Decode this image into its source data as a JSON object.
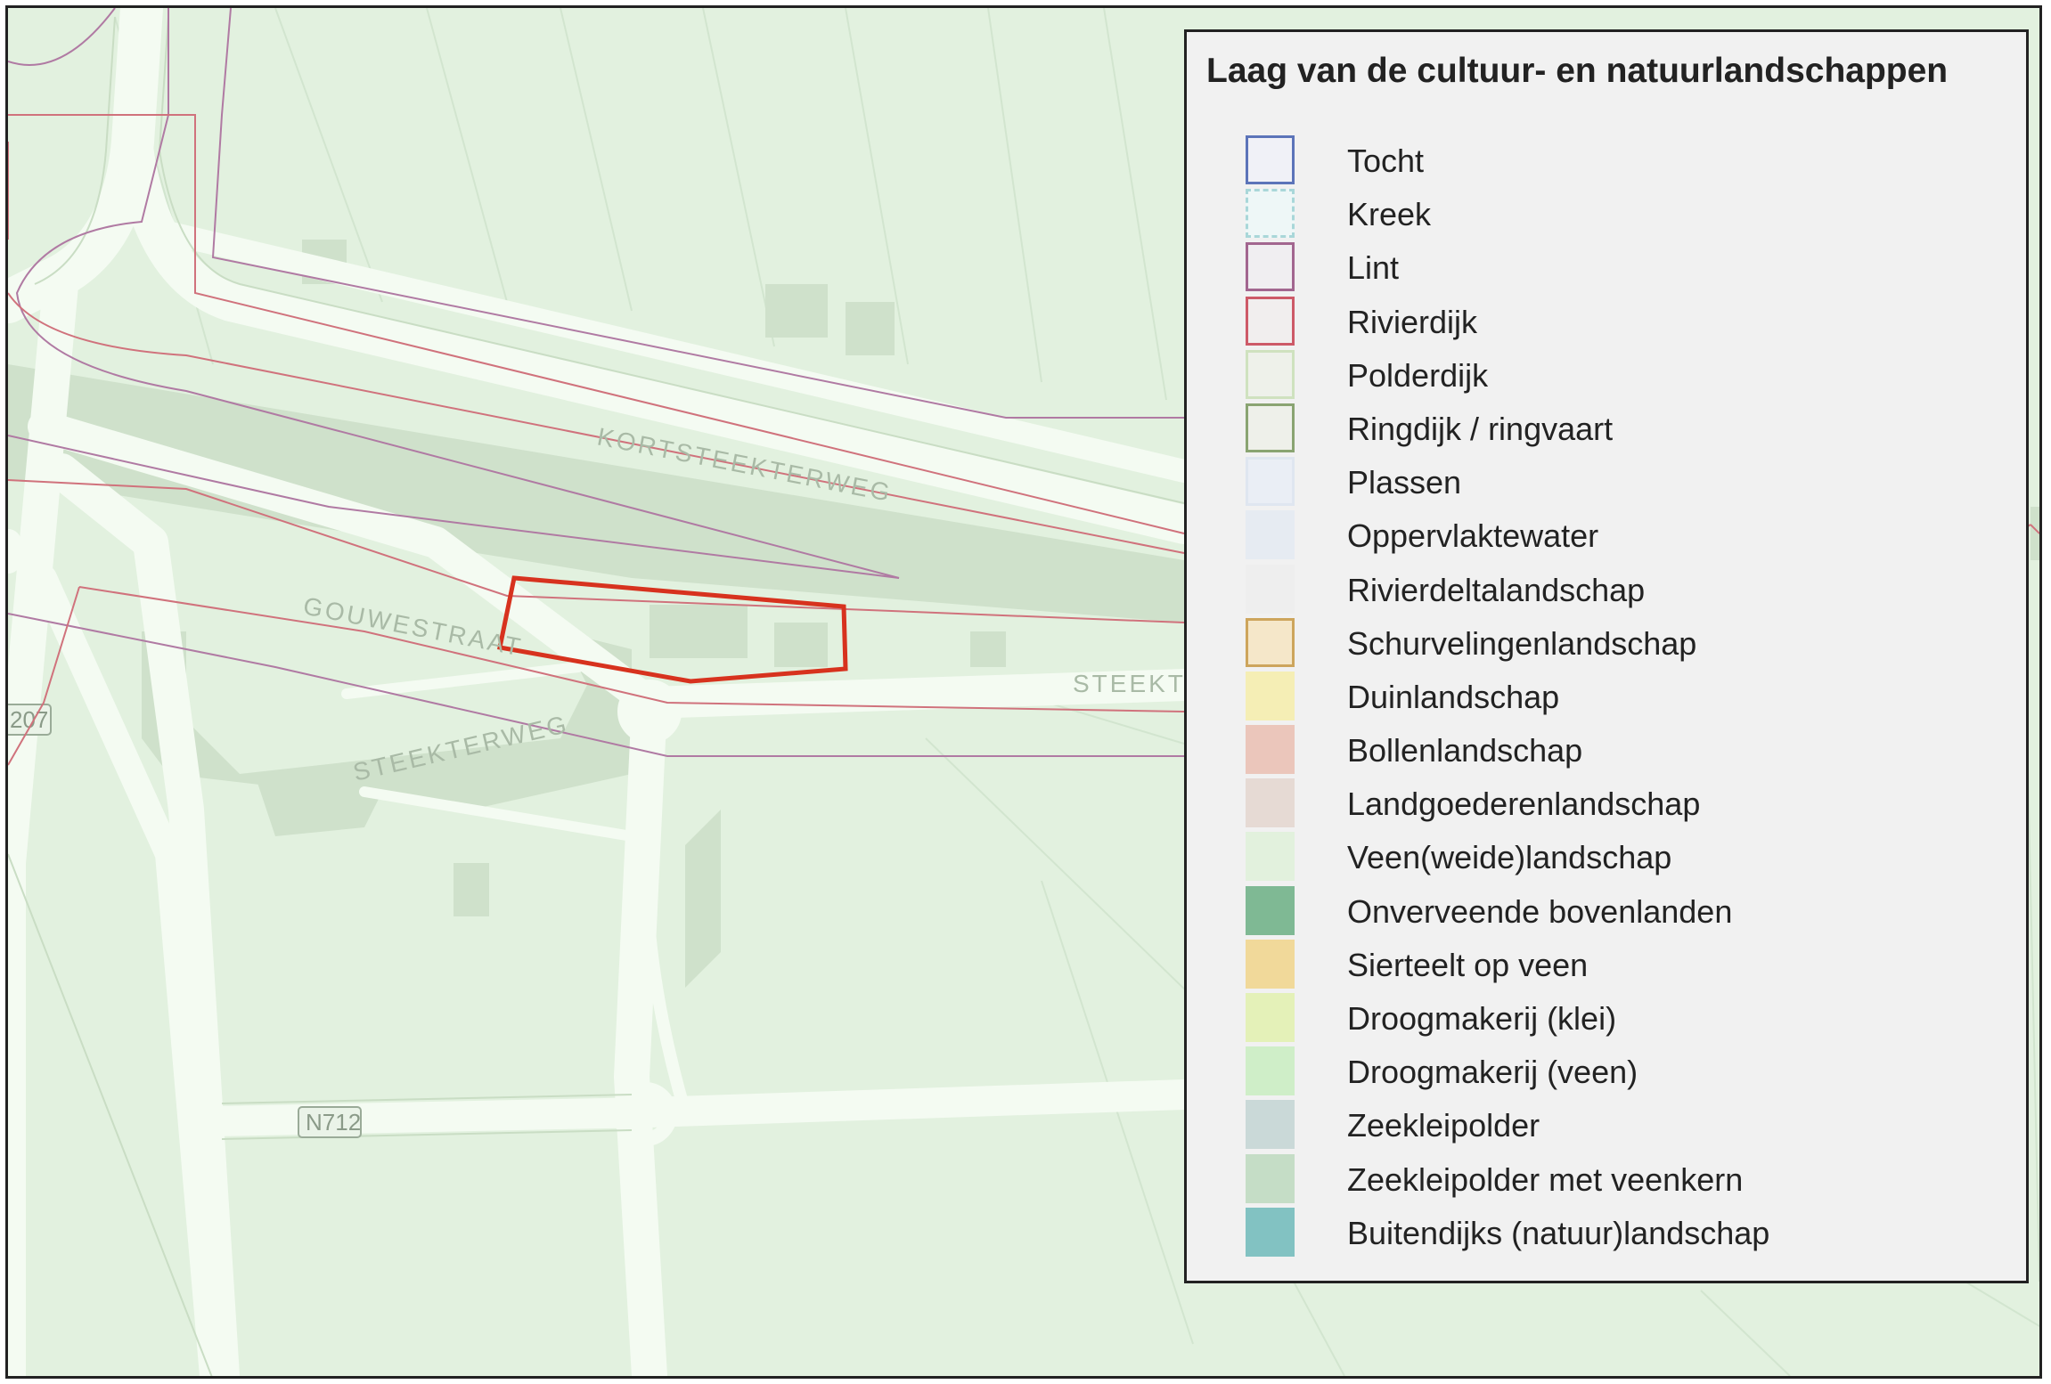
{
  "map": {
    "road_labels": {
      "kortsteekterweg": "KORTSTEEKTERWEG",
      "gouwestraat": "GOUWESTRAAT",
      "steekterweg": "STEEKTERWEG",
      "steekt": "STEEKT"
    },
    "route_labels": {
      "n712": "N712",
      "n207": "207"
    },
    "colors": {
      "background": "#e2f1df",
      "roads": "#f4fbf2",
      "buildings": "#cfe1cb",
      "lint_line": "#b07aa3",
      "rivierdijk_line": "#d0727c",
      "study_area": "#d7321e"
    }
  },
  "legend": {
    "title": "Laag van de cultuur- en natuurlandschappen",
    "items": [
      {
        "label": "Tocht",
        "fill": "#f0f1f7",
        "border": "#5c74b9",
        "style": "solid"
      },
      {
        "label": "Kreek",
        "fill": "#eef7f7",
        "border": "#a9d7d9",
        "style": "dashed"
      },
      {
        "label": "Lint",
        "fill": "#f0eef1",
        "border": "#a2668f",
        "style": "solid"
      },
      {
        "label": "Rivierdijk",
        "fill": "#f1eeee",
        "border": "#cd5a68",
        "style": "solid"
      },
      {
        "label": "Polderdijk",
        "fill": "#eef1ea",
        "border": "#cfe2bf",
        "style": "solid"
      },
      {
        "label": "Ringdijk / ringvaart",
        "fill": "#eef0ea",
        "border": "#8aa472",
        "style": "solid"
      },
      {
        "label": "Plassen",
        "fill": "#eaeef5",
        "border": "#dfe6f0",
        "style": "solid"
      },
      {
        "label": "Oppervlaktewater",
        "fill": "#e6ebf2",
        "border": "#e6ebf2",
        "style": "none"
      },
      {
        "label": "Rivierdeltalandschap",
        "fill": "#eeeeee",
        "border": "#eeeeee",
        "style": "none"
      },
      {
        "label": "Schurvelingenlandschap",
        "fill": "#f5e7c9",
        "border": "#cda55c",
        "style": "solid"
      },
      {
        "label": "Duinlandschap",
        "fill": "#f5eeb5",
        "border": "#f5eeb5",
        "style": "none"
      },
      {
        "label": "Bollenlandschap",
        "fill": "#ebc6bb",
        "border": "#ebc6bb",
        "style": "none"
      },
      {
        "label": "Landgoederenlandschap",
        "fill": "#e6dad4",
        "border": "#e6dad4",
        "style": "none"
      },
      {
        "label": "Veen(weide)landschap",
        "fill": "#e2f1dd",
        "border": "#e2f1dd",
        "style": "none"
      },
      {
        "label": "Onverveende bovenlanden",
        "fill": "#7fb994",
        "border": "#7fb994",
        "style": "none"
      },
      {
        "label": "Sierteelt op veen",
        "fill": "#f1d99a",
        "border": "#f1d99a",
        "style": "none"
      },
      {
        "label": "Droogmakerij (klei)",
        "fill": "#e4f1b8",
        "border": "#e4f1b8",
        "style": "none"
      },
      {
        "label": "Droogmakerij (veen)",
        "fill": "#cfeec8",
        "border": "#cfeec8",
        "style": "none"
      },
      {
        "label": "Zeekleipolder",
        "fill": "#cad9d8",
        "border": "#cad9d8",
        "style": "none"
      },
      {
        "label": "Zeekleipolder met veenkern",
        "fill": "#c5ddc6",
        "border": "#c5ddc6",
        "style": "none"
      },
      {
        "label": "Buitendijks (natuur)landschap",
        "fill": "#82c2c2",
        "border": "#82c2c2",
        "style": "none"
      }
    ]
  }
}
